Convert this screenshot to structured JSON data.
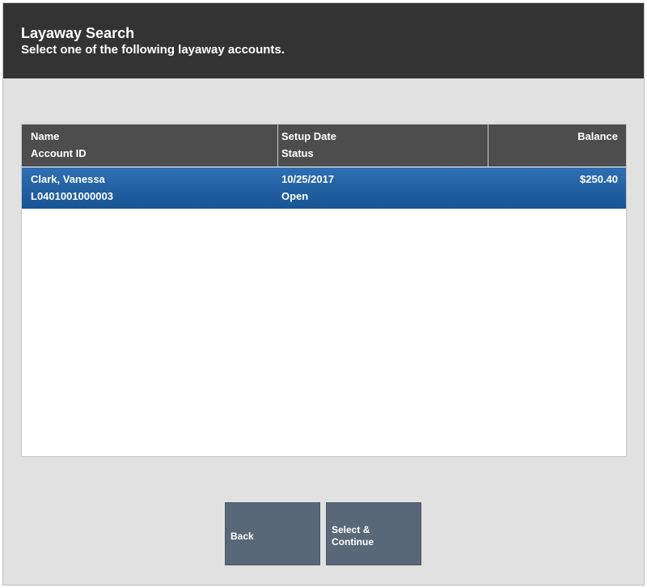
{
  "header": {
    "title": "Layaway Search",
    "subtitle": "Select one of the following layaway accounts."
  },
  "table": {
    "columns": {
      "name_line1": "Name",
      "name_line2": "Account ID",
      "date_line1": "Setup Date",
      "date_line2": "Status",
      "balance": "Balance"
    },
    "rows": [
      {
        "name": "Clark, Vanessa",
        "account_id": "L0401001000003",
        "setup_date": "10/25/2017",
        "status": "Open",
        "balance": "$250.40",
        "selected": true
      }
    ]
  },
  "buttons": {
    "back": "Back",
    "select_continue": "Select &\nContinue"
  },
  "colors": {
    "header_bg": "#333333",
    "selected_row": "#2a67a8",
    "button_bg": "#586878"
  }
}
